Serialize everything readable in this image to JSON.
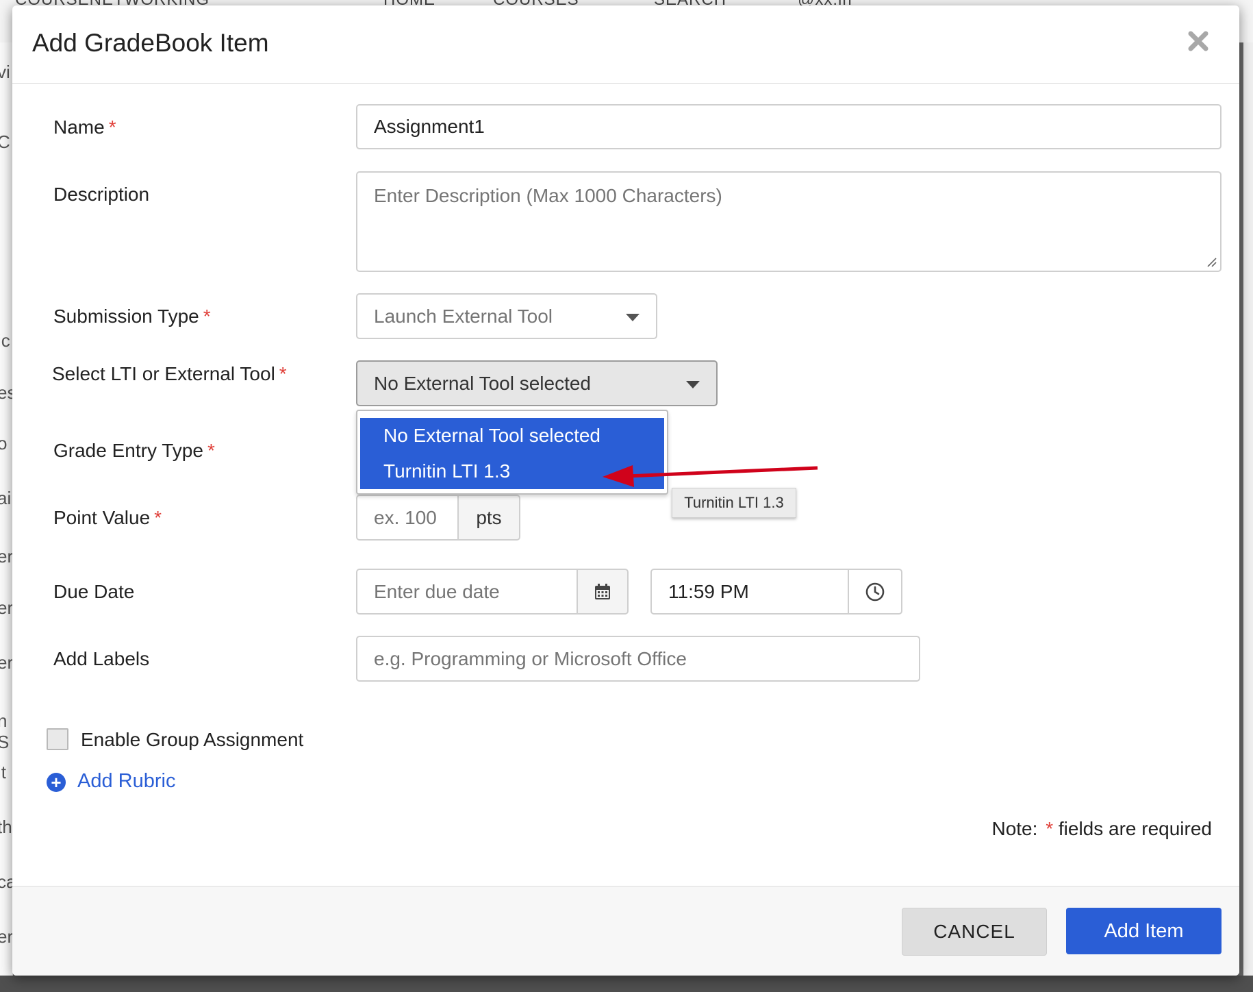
{
  "background": {
    "topbar_items": [
      "COURSENETWORKING",
      "HOME",
      "COURSES",
      "SEARCH",
      "@xx.in"
    ],
    "left_edge_chars": [
      "vi",
      "C",
      "ic",
      "es",
      "o",
      "ai",
      "er",
      "er",
      "er",
      "n S",
      "it",
      "th",
      "ca",
      "er"
    ]
  },
  "modal": {
    "title": "Add GradeBook Item",
    "close_icon": "close-icon"
  },
  "form": {
    "required_marker": "*",
    "name": {
      "label": "Name",
      "value": "Assignment1"
    },
    "description": {
      "label": "Description",
      "placeholder": "Enter Description (Max 1000 Characters)"
    },
    "submission_type": {
      "label": "Submission Type",
      "value": "Launch External Tool"
    },
    "lti_tool": {
      "label": "Select LTI or External Tool",
      "value": "No External Tool selected",
      "options": [
        "No External Tool selected",
        "Turnitin LTI 1.3"
      ],
      "tooltip": "Turnitin LTI 1.3"
    },
    "grade_entry_type": {
      "label": "Grade Entry Type"
    },
    "point_value": {
      "label": "Point Value",
      "placeholder": "ex. 100",
      "unit": "pts"
    },
    "due_date": {
      "label": "Due Date",
      "placeholder": "Enter due date",
      "time": "11:59 PM"
    },
    "labels": {
      "label": "Add Labels",
      "placeholder": "e.g. Programming or Microsoft Office"
    },
    "group_assignment": {
      "label": "Enable Group Assignment",
      "checked": false
    },
    "add_rubric": "Add Rubric",
    "note": {
      "prefix": "Note:",
      "suffix": "fields are required"
    }
  },
  "footer": {
    "cancel": "CANCEL",
    "add": "Add Item"
  },
  "colors": {
    "accent": "#2a5ed6",
    "required": "#e0403a",
    "annotation_arrow": "#d0021b"
  }
}
